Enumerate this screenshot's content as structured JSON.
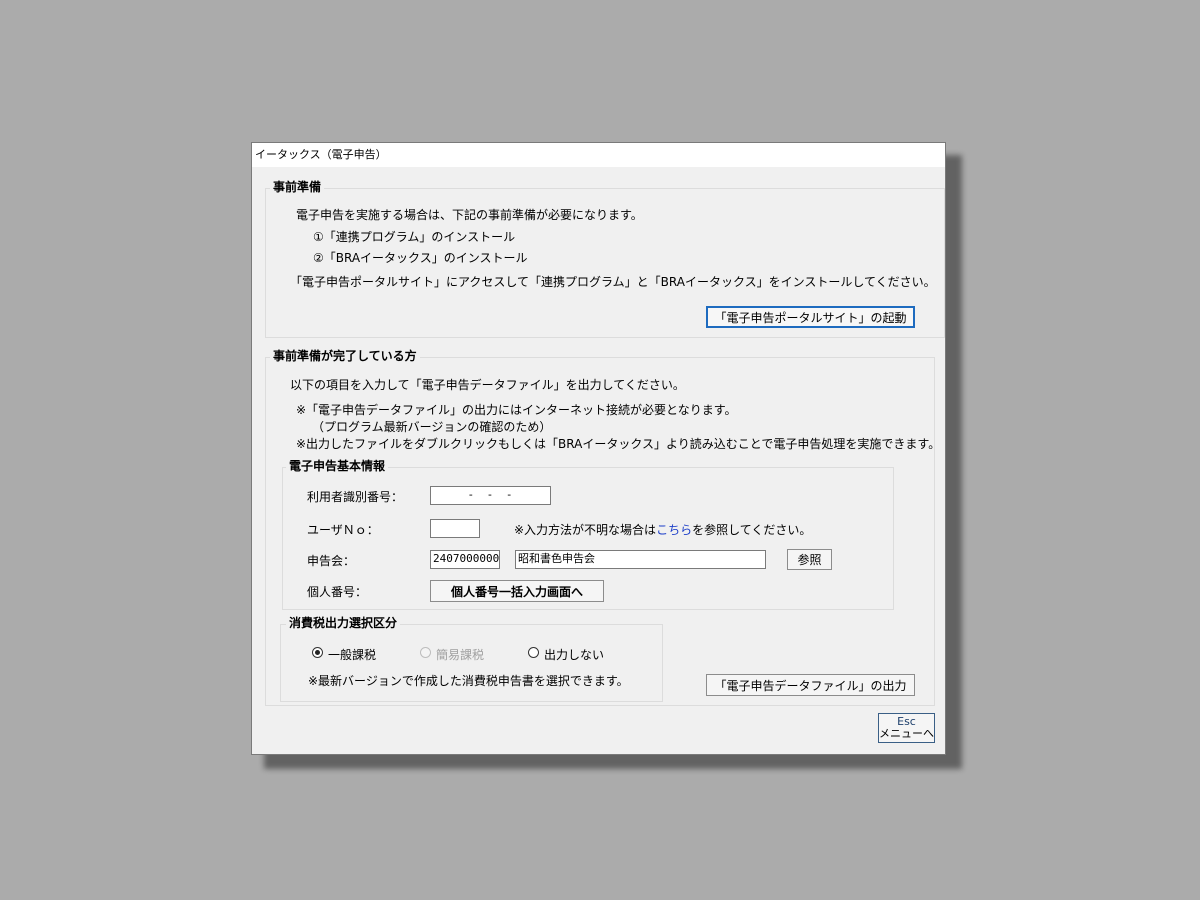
{
  "window": {
    "title": "イータックス（電子申告）"
  },
  "prep": {
    "legend": "事前準備",
    "intro": "電子申告を実施する場合は、下記の事前準備が必要になります。",
    "item1": "①「連携プログラム」のインストール",
    "item2": "②「BRAイータックス」のインストール",
    "note": "「電子申告ポータルサイト」にアクセスして「連携プログラム」と「BRAイータックス」をインストールしてください。",
    "portal_button": "「電子申告ポータルサイト」の起動"
  },
  "done": {
    "legend": "事前準備が完了している方",
    "intro": "以下の項目を入力して「電子申告データファイル」を出力してください。",
    "note1": "※「電子申告データファイル」の出力にはインターネット接続が必要となります。",
    "note1b": "（プログラム最新バージョンの確認のため）",
    "note2": "※出力したファイルをダブルクリックもしくは「BRAイータックス」より読み込むことで電子申告処理を実施できます。"
  },
  "basic": {
    "legend": "電子申告基本情報",
    "user_id_label": "利用者識別番号：",
    "user_id_value": "-   -   -",
    "user_no_label": "ユーザＮｏ：",
    "user_no_value": "",
    "help_prefix": "※入力方法が不明な場合は",
    "help_link": "こちら",
    "help_suffix": "を参照してください。",
    "assoc_label": "申告会：",
    "assoc_code": "2407000000",
    "assoc_name": "昭和書色申告会",
    "browse_button": "参照",
    "personal_label": "個人番号：",
    "personal_button": "個人番号一括入力画面へ"
  },
  "tax": {
    "legend": "消費税出力選択区分",
    "option1": "一般課税",
    "option2": "簡易課税",
    "option3": "出力しない",
    "selected": "一般課税",
    "note": "※最新バージョンで作成した消費税申告書を選択できます。"
  },
  "output_button": "「電子申告データファイル」の出力",
  "menu_button": {
    "line1": "Esc",
    "line2": "メニューへ"
  }
}
